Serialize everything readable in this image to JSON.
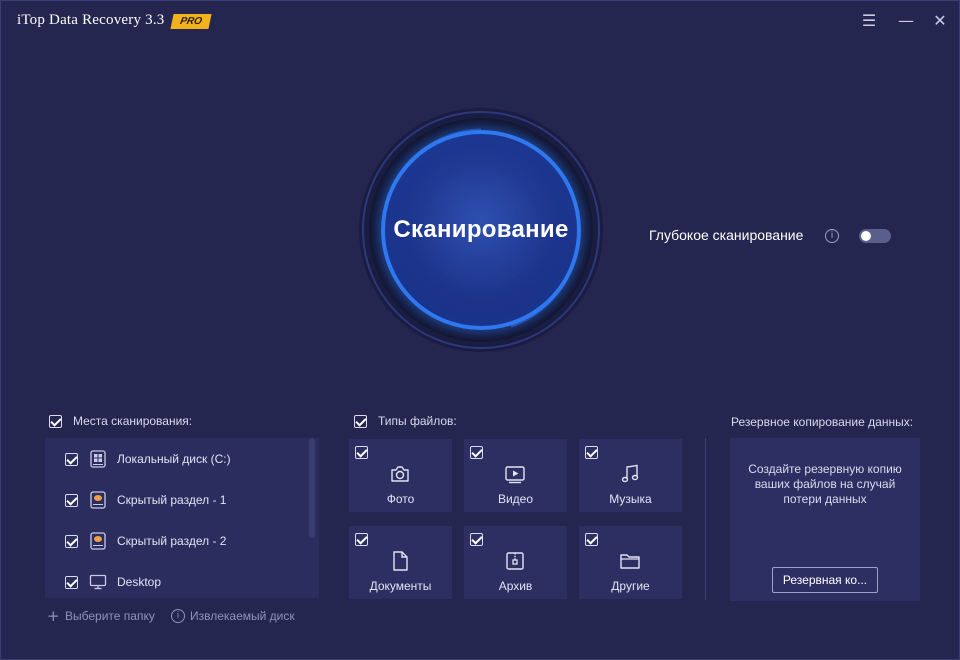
{
  "app": {
    "title": "iTop Data Recovery 3.3",
    "badge": "PRO"
  },
  "window_controls": {
    "menu": "☰",
    "minimize": "—",
    "close": "✕"
  },
  "scan": {
    "label": "Сканирование"
  },
  "deep_scan": {
    "label": "Глубокое сканирование",
    "info": "i",
    "enabled": false
  },
  "locations": {
    "header": "Места сканирования:",
    "checked": true,
    "items": [
      {
        "label": "Локальный диск (C:)",
        "icon": "windows-drive-icon",
        "checked": true
      },
      {
        "label": "Скрытый раздел - 1",
        "icon": "hidden-drive-icon",
        "checked": true
      },
      {
        "label": "Скрытый раздел - 2",
        "icon": "hidden-drive-icon",
        "checked": true
      },
      {
        "label": "Desktop",
        "icon": "monitor-icon",
        "checked": true
      }
    ],
    "actions": {
      "select_folder": "Выберите папку",
      "removable": "Извлекаемый диск"
    }
  },
  "file_types": {
    "header": "Типы файлов:",
    "checked": true,
    "items": [
      {
        "label": "Фото",
        "icon": "camera-icon",
        "checked": true
      },
      {
        "label": "Видео",
        "icon": "video-icon",
        "checked": true
      },
      {
        "label": "Музыка",
        "icon": "music-note-icon",
        "checked": true
      },
      {
        "label": "Документы",
        "icon": "document-icon",
        "checked": true
      },
      {
        "label": "Архив",
        "icon": "archive-icon",
        "checked": true
      },
      {
        "label": "Другие",
        "icon": "folder-icon",
        "checked": true
      }
    ]
  },
  "backup": {
    "header": "Резервное копирование данных:",
    "description": "Создайте резервную копию ваших файлов на случай потери данных",
    "button": "Резервная ко..."
  },
  "colors": {
    "background": "#24264f",
    "panel": "#2d2f62",
    "accent": "#2e78f0",
    "badge": "#f2b21b"
  }
}
